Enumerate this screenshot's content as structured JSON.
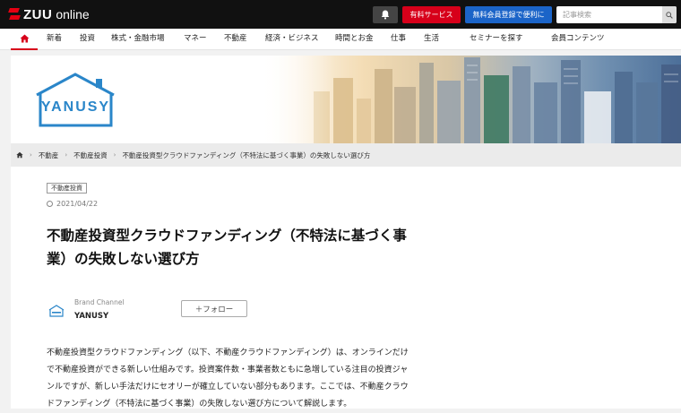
{
  "header": {
    "logo_text": "ZUU",
    "logo_sub": "online",
    "notifications_icon": "bell-icon",
    "paid_service_label": "有料サービス",
    "free_register_label": "無料会員登録で便利に",
    "search_placeholder": "記事検索",
    "search_icon": "search-icon"
  },
  "nav": {
    "home_icon": "home-icon",
    "items": [
      "新着",
      "投資",
      "株式・金融市場",
      "マネー",
      "不動産",
      "経済・ビジネス",
      "時間とお金",
      "仕事",
      "生活",
      "セミナーを探す",
      "会員コンテンツ"
    ]
  },
  "banner": {
    "brand_logo_text": "YANUSY"
  },
  "breadcrumb": {
    "home_icon": "home-icon",
    "items": [
      "不動産",
      "不動産投資",
      "不動産投資型クラウドファンディング（不特法に基づく事業）の失敗しない選び方"
    ]
  },
  "article": {
    "tag": "不動産投資",
    "date": "2021/04/22",
    "title_line1": "不動産投資型クラウドファンディング（不特法に基づく事",
    "title_line2": "業）の失敗しない選び方",
    "brand_channel_label": "Brand Channel",
    "brand_name": "YANUSY",
    "follow_label": "＋フォロー",
    "body_lines": [
      "不動産投資型クラウドファンディング（以下、不動産クラウドファンディング）は、オンラインだけ",
      "で不動産投資ができる新しい仕組みです。投資案件数・事業者数ともに急増している注目の投資ジャ",
      "ンルですが、新しい手法だけにセオリーが確立していない部分もあります。ここでは、不動産クラウ",
      "ドファンディング（不特法に基づく事業）の失敗しない選び方について解説します。"
    ]
  },
  "colors": {
    "topbar": "#111111",
    "accent_red": "#d7001a",
    "accent_blue": "#1b64c8",
    "yanusy_blue": "#2a86c9"
  }
}
